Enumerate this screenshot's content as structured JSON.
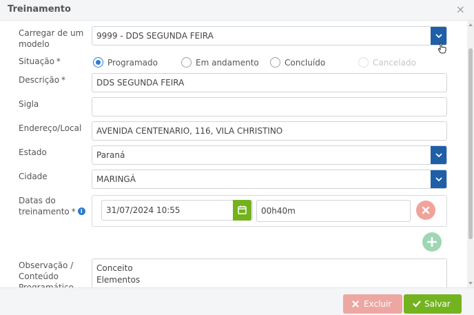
{
  "dialog": {
    "title": "Treinamento",
    "close_symbol": "×"
  },
  "form": {
    "template": {
      "label_line1": "Carregar de um",
      "label_line2": "modelo",
      "value": "9999 - DDS SEGUNDA FEIRA"
    },
    "situacao": {
      "label": "Situação",
      "required_mark": "*",
      "options": [
        "Programado",
        "Em andamento",
        "Concluído",
        "Cancelado"
      ],
      "selected": "Programado",
      "disabled": [
        "Cancelado"
      ]
    },
    "descricao": {
      "label": "Descrição",
      "required_mark": "*",
      "value": "DDS SEGUNDA FEIRA"
    },
    "sigla": {
      "label": "Sigla",
      "value": ""
    },
    "endereco": {
      "label": "Endereço/Local",
      "value": "AVENIDA CENTENARIO, 116, VILA CHRISTINO"
    },
    "estado": {
      "label": "Estado",
      "value": "Paraná"
    },
    "cidade": {
      "label": "Cidade",
      "value": "MARINGÁ"
    },
    "datas": {
      "label_line1": "Datas do",
      "label_line2": "treinamento",
      "required_mark": "*",
      "info_symbol": "i",
      "start": "31/07/2024 10:55",
      "duration": "00h40m"
    },
    "observacao": {
      "label_line1": "Observação /",
      "label_line2": "Conteúdo",
      "label_line3": "Programático",
      "lines": [
        "Conceito",
        "Elementos"
      ]
    }
  },
  "footer": {
    "delete_label": "Excluir",
    "save_label": "Salvar"
  },
  "colors": {
    "select_button": "#1e5fa8",
    "calendar_button": "#73b11e",
    "save": "#74b320",
    "delete": "#eda7a2",
    "radio_accent": "#2a7bd1"
  }
}
